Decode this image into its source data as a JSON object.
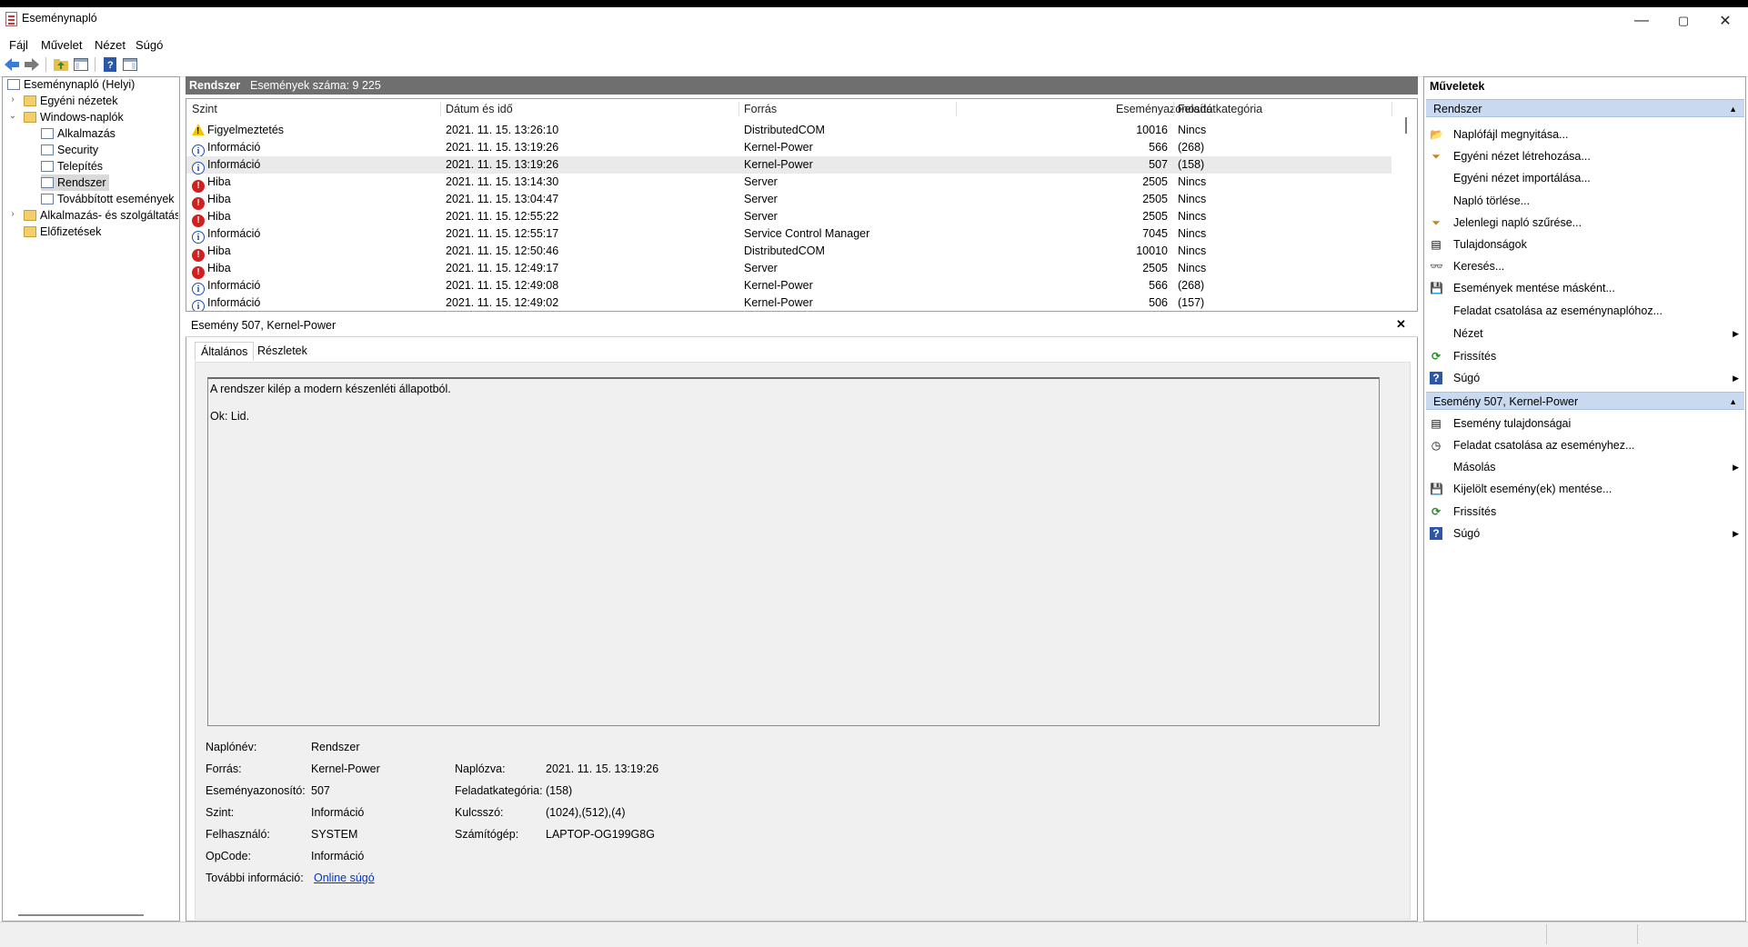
{
  "window": {
    "title": "Eseménynapló",
    "controls": {
      "minimize": "—",
      "maximize": "▢",
      "close": "✕"
    }
  },
  "menu": [
    "Fájl",
    "Művelet",
    "Nézet",
    "Súgó"
  ],
  "toolbar": {
    "icons": [
      "back-icon",
      "forward-icon",
      "up-folder-icon",
      "show-hide-tree-icon",
      "help-icon",
      "show-hide-actions-icon"
    ]
  },
  "tree": {
    "root": "Eseménynapló (Helyi)",
    "custom_views": "Egyéni nézetek",
    "windows_logs": "Windows-naplók",
    "logs": [
      "Alkalmazás",
      "Security",
      "Telepítés",
      "Rendszer",
      "Továbbított események"
    ],
    "app_services": "Alkalmazás- és szolgáltatásn",
    "subscriptions": "Előfizetések"
  },
  "center": {
    "header_title": "Rendszer",
    "header_count": "Események száma: 9 225",
    "columns": [
      "Szint",
      "Dátum és idő",
      "Forrás",
      "Eseményazonosító",
      "Feladatkategória"
    ],
    "rows": [
      {
        "level": "Figyelmeztetés",
        "type": "warn",
        "date": "2021. 11. 15. 13:26:10",
        "source": "DistributedCOM",
        "id": "10016",
        "cat": "Nincs"
      },
      {
        "level": "Információ",
        "type": "info",
        "date": "2021. 11. 15. 13:19:26",
        "source": "Kernel-Power",
        "id": "566",
        "cat": "(268)"
      },
      {
        "level": "Információ",
        "type": "info",
        "date": "2021. 11. 15. 13:19:26",
        "source": "Kernel-Power",
        "id": "507",
        "cat": "(158)",
        "selected": true
      },
      {
        "level": "Hiba",
        "type": "err",
        "date": "2021. 11. 15. 13:14:30",
        "source": "Server",
        "id": "2505",
        "cat": "Nincs"
      },
      {
        "level": "Hiba",
        "type": "err",
        "date": "2021. 11. 15. 13:04:47",
        "source": "Server",
        "id": "2505",
        "cat": "Nincs"
      },
      {
        "level": "Hiba",
        "type": "err",
        "date": "2021. 11. 15. 12:55:22",
        "source": "Server",
        "id": "2505",
        "cat": "Nincs"
      },
      {
        "level": "Információ",
        "type": "info",
        "date": "2021. 11. 15. 12:55:17",
        "source": "Service Control Manager",
        "id": "7045",
        "cat": "Nincs"
      },
      {
        "level": "Hiba",
        "type": "err",
        "date": "2021. 11. 15. 12:50:46",
        "source": "DistributedCOM",
        "id": "10010",
        "cat": "Nincs"
      },
      {
        "level": "Hiba",
        "type": "err",
        "date": "2021. 11. 15. 12:49:17",
        "source": "Server",
        "id": "2505",
        "cat": "Nincs"
      },
      {
        "level": "Információ",
        "type": "info",
        "date": "2021. 11. 15. 12:49:08",
        "source": "Kernel-Power",
        "id": "566",
        "cat": "(268)"
      },
      {
        "level": "Információ",
        "type": "info",
        "date": "2021. 11. 15. 12:49:02",
        "source": "Kernel-Power",
        "id": "506",
        "cat": "(157)"
      }
    ]
  },
  "detail": {
    "title": "Esemény 507, Kernel-Power",
    "close": "✕",
    "tabs": [
      "Általános",
      "Részletek"
    ],
    "message_line1": "A rendszer kilép a modern készenléti állapotból.",
    "message_line2": "Ok: Lid.",
    "fields": {
      "log_name_label": "Naplónév:",
      "log_name": "Rendszer",
      "source_label": "Forrás:",
      "source": "Kernel-Power",
      "logged_label": "Naplózva:",
      "logged": "2021. 11. 15. 13:19:26",
      "event_id_label": "Eseményazonosító:",
      "event_id": "507",
      "task_cat_label": "Feladatkategória:",
      "task_cat": "(158)",
      "level_label": "Szint:",
      "level": "Információ",
      "keywords_label": "Kulcsszó:",
      "keywords": "(1024),(512),(4)",
      "user_label": "Felhasználó:",
      "user": "SYSTEM",
      "computer_label": "Számítógép:",
      "computer": "LAPTOP-OG199G8G",
      "opcode_label": "OpCode:",
      "opcode": "Információ",
      "more_info_label": "További információ:",
      "more_info_link": "Online súgó"
    }
  },
  "actions": {
    "title": "Műveletek",
    "section1": "Rendszer",
    "section1_items": [
      "Naplófájl megnyitása...",
      "Egyéni nézet létrehozása...",
      "Egyéni nézet importálása...",
      "Napló törlése...",
      "Jelenlegi napló szűrése...",
      "Tulajdonságok",
      "Keresés...",
      "Események mentése másként...",
      "Feladat csatolása az eseménynaplóhoz...",
      "Nézet",
      "Frissítés",
      "Súgó"
    ],
    "section2": "Esemény 507, Kernel-Power",
    "section2_items": [
      "Esemény tulajdonságai",
      "Feladat csatolása az eseményhez...",
      "Másolás",
      "Kijelölt esemény(ek) mentése...",
      "Frissítés",
      "Súgó"
    ]
  }
}
